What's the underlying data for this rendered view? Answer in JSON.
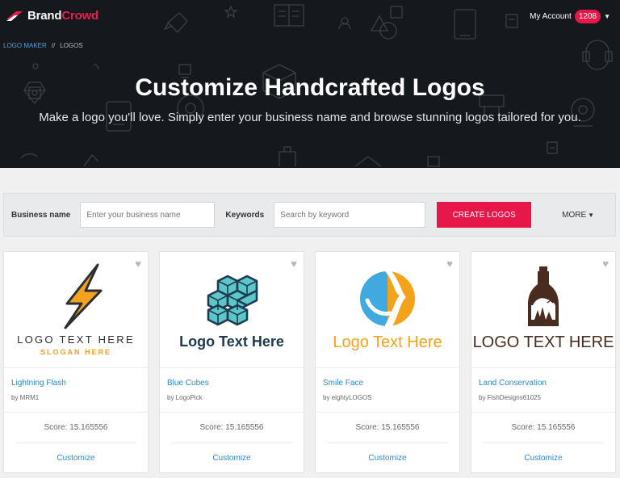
{
  "header": {
    "brand_a": "Brand",
    "brand_b": "Crowd",
    "account_label": "My Account",
    "account_count": "1208",
    "breadcrumb": [
      "LOGO MAKER",
      "//",
      "LOGOS"
    ]
  },
  "hero": {
    "title": "Customize Handcrafted Logos",
    "subtitle": "Make a logo you'll love. Simply enter your business name and browse stunning logos tailored for you."
  },
  "search": {
    "business_label": "Business name",
    "business_placeholder": "Enter your business name",
    "keywords_label": "Keywords",
    "keywords_placeholder": "Search by keyword",
    "create_label": "CREATE LOGOS",
    "more_label": "MORE"
  },
  "cards": [
    {
      "title": "Lightning Flash",
      "author": "by MRM1",
      "score": "Score: 15.165556",
      "action": "Customize",
      "logo_text": "LOGO TEXT HERE",
      "logo_sub": "SLOGAN HERE",
      "icon": "lightning-bolt-icon"
    },
    {
      "title": "Blue Cubes",
      "author": "by LogoPick",
      "score": "Score: 15.165556",
      "action": "Customize",
      "logo_text": "Logo Text Here",
      "icon": "cubes-icon"
    },
    {
      "title": "Smile Face",
      "author": "by eightyLOGOS",
      "score": "Score: 15.165556",
      "action": "Customize",
      "logo_text": "Logo Text Here",
      "icon": "smile-face-icon"
    },
    {
      "title": "Land Conservation",
      "author": "by FishDesigns61025",
      "score": "Score: 15.165556",
      "action": "Customize",
      "logo_text": "LOGO TEXT HERE",
      "icon": "bottle-icon"
    }
  ],
  "colors": {
    "brand_red": "#e8174a",
    "link_blue": "#2b8bd1",
    "hero_bg": "#15181c"
  }
}
